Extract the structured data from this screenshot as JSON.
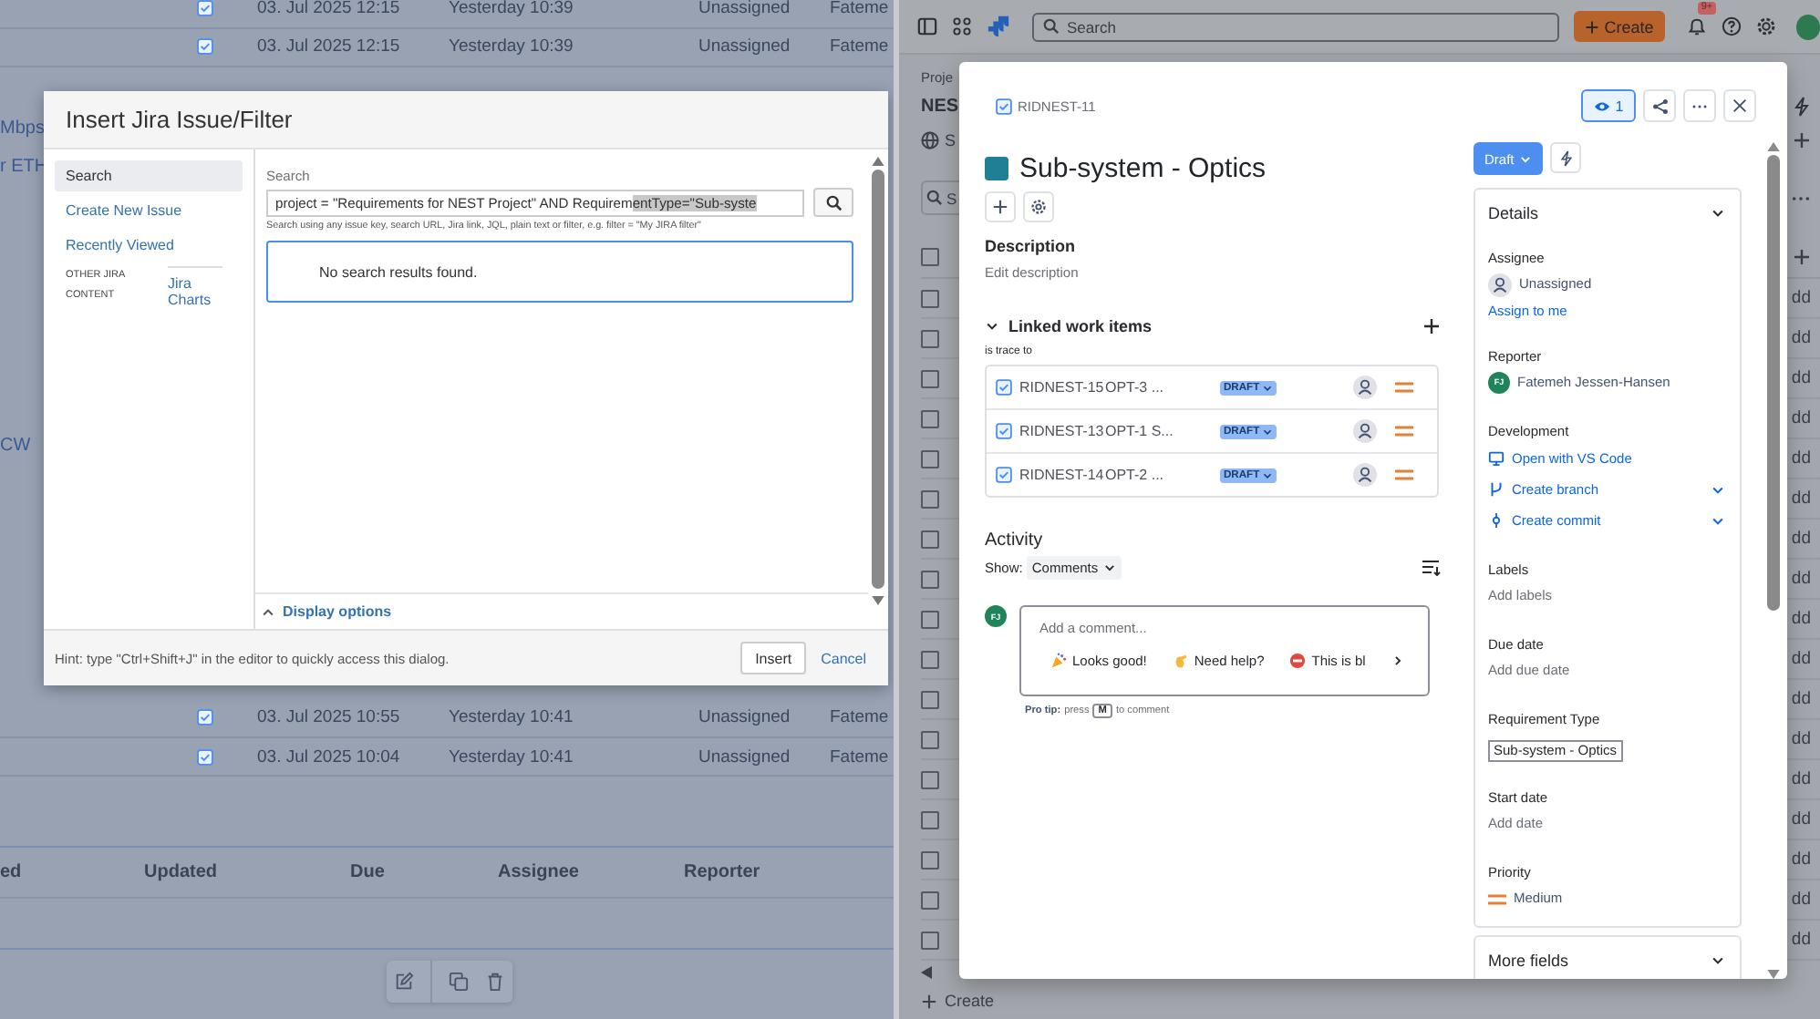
{
  "confluence_page": {
    "rows_above_dialog": [
      {
        "created": "03. Jul 2025 12:15",
        "updated": "Yesterday 10:39",
        "assignee": "Unassigned",
        "reporter": "Fateme"
      },
      {
        "created": "03. Jul 2025 12:15",
        "updated": "Yesterday 10:39",
        "assignee": "Unassigned",
        "reporter": "Fateme"
      }
    ],
    "link_fragments": [
      "Mbps",
      "r ETH",
      "CW"
    ],
    "rows_below_dialog": [
      {
        "created": "03. Jul 2025 10:55",
        "updated": "Yesterday 10:41",
        "assignee": "Unassigned",
        "reporter": "Fateme"
      },
      {
        "created": "03. Jul 2025 10:04",
        "updated": "Yesterday 10:41",
        "assignee": "Unassigned",
        "reporter": "Fateme"
      }
    ],
    "columns": [
      "ed",
      "Updated",
      "Due",
      "Assignee",
      "Reporter"
    ]
  },
  "insert_dialog": {
    "title": "Insert Jira Issue/Filter",
    "nav": [
      {
        "label": "Search",
        "selected": true
      },
      {
        "label": "Create New Issue",
        "selected": false
      },
      {
        "label": "Recently Viewed",
        "selected": false
      }
    ],
    "other_heading": "OTHER JIRA CONTENT",
    "other_links": [
      "Jira Charts"
    ],
    "search_label": "Search",
    "search_value": "project = \"Requirements for NEST Project\" AND Requirem",
    "search_selected_value": "entType=\"Sub-syste",
    "search_hint": "Search using any issue key, search URL, Jira link, JQL, plain text or filter, e.g. filter = \"My JIRA filter\"",
    "results_message": "No search results found.",
    "display_options": "Display options",
    "hint": "Hint: type \"Ctrl+Shift+J\" in the editor to quickly access this dialog.",
    "buttons": [
      {
        "label": "Insert",
        "kind": "button"
      },
      {
        "label": "Cancel",
        "kind": "link"
      }
    ]
  },
  "jira": {
    "search_placeholder": "Search",
    "create": "Create",
    "notification_badge": "9+",
    "breadcrumb": "Proje",
    "project": "NES",
    "tab": "S",
    "filter_field": "S",
    "select_all_checked": false,
    "rows": [
      {
        "action": "dd",
        "checked": false
      },
      {
        "action": "dd",
        "checked": false
      },
      {
        "action": "dd",
        "checked": false
      },
      {
        "action": "dd",
        "checked": false
      },
      {
        "action": "dd",
        "checked": false
      },
      {
        "action": "dd",
        "checked": false
      },
      {
        "action": "dd",
        "checked": false
      },
      {
        "action": "dd",
        "checked": false
      },
      {
        "action": "dd",
        "checked": false
      },
      {
        "action": "dd",
        "checked": false
      },
      {
        "action": "dd",
        "checked": false
      },
      {
        "action": "dd",
        "checked": false
      },
      {
        "action": "dd",
        "checked": false
      },
      {
        "action": "dd",
        "checked": false
      },
      {
        "action": "dd",
        "checked": false
      },
      {
        "action": "dd",
        "checked": false
      },
      {
        "action": "dd",
        "checked": false
      }
    ],
    "footer_create": "Create",
    "issue": {
      "key": "RIDNEST-11",
      "watchers": "1",
      "title": "Sub-system - Optics",
      "status": "Draft",
      "description_heading": "Description",
      "description_placeholder": "Edit description",
      "linked_heading": "Linked work items",
      "link_type": "is trace to",
      "linked_items": [
        {
          "key": "RIDNEST-15",
          "summary": "OPT-3 ...",
          "status": "DRAFT"
        },
        {
          "key": "RIDNEST-13",
          "summary": "OPT-1 S...",
          "status": "DRAFT"
        },
        {
          "key": "RIDNEST-14",
          "summary": "OPT-2 ...",
          "status": "DRAFT"
        }
      ],
      "activity_heading": "Activity",
      "show_label": "Show:",
      "show_filter": "Comments",
      "comment_avatar": "FJ",
      "comment_placeholder": "Add a comment...",
      "quick_replies": [
        {
          "label": "Looks good!",
          "kind": "celebrate"
        },
        {
          "label": "Need help?",
          "kind": "help"
        },
        {
          "label": "This is bl",
          "kind": "blocked"
        }
      ],
      "pro_tip": {
        "label": "Pro tip:",
        "before": "press",
        "key": "M",
        "after": "to comment"
      },
      "details_heading": "Details",
      "fields": [
        {
          "label": "Assignee",
          "kind": "assignee",
          "value": "Unassigned",
          "action": "Assign to me"
        },
        {
          "label": "Reporter",
          "kind": "user",
          "value": "Fatemeh Jessen-Hansen",
          "initials": "FJ"
        },
        {
          "label": "Development",
          "kind": "links",
          "links": [
            {
              "label": "Open with VS Code",
              "kind": "editor",
              "has_menu": false
            },
            {
              "label": "Create branch",
              "kind": "branch",
              "has_menu": true
            },
            {
              "label": "Create commit",
              "kind": "commit",
              "has_menu": true
            }
          ]
        },
        {
          "label": "Labels",
          "kind": "empty",
          "value": "Add labels"
        },
        {
          "label": "Due date",
          "kind": "empty",
          "value": "Add due date"
        },
        {
          "label": "Requirement Type",
          "kind": "tag",
          "value": "Sub-system - Optics"
        },
        {
          "label": "Start date",
          "kind": "empty",
          "value": "Add date"
        },
        {
          "label": "Priority",
          "kind": "priority",
          "value": "Medium"
        }
      ],
      "more_fields": "More fields"
    }
  }
}
